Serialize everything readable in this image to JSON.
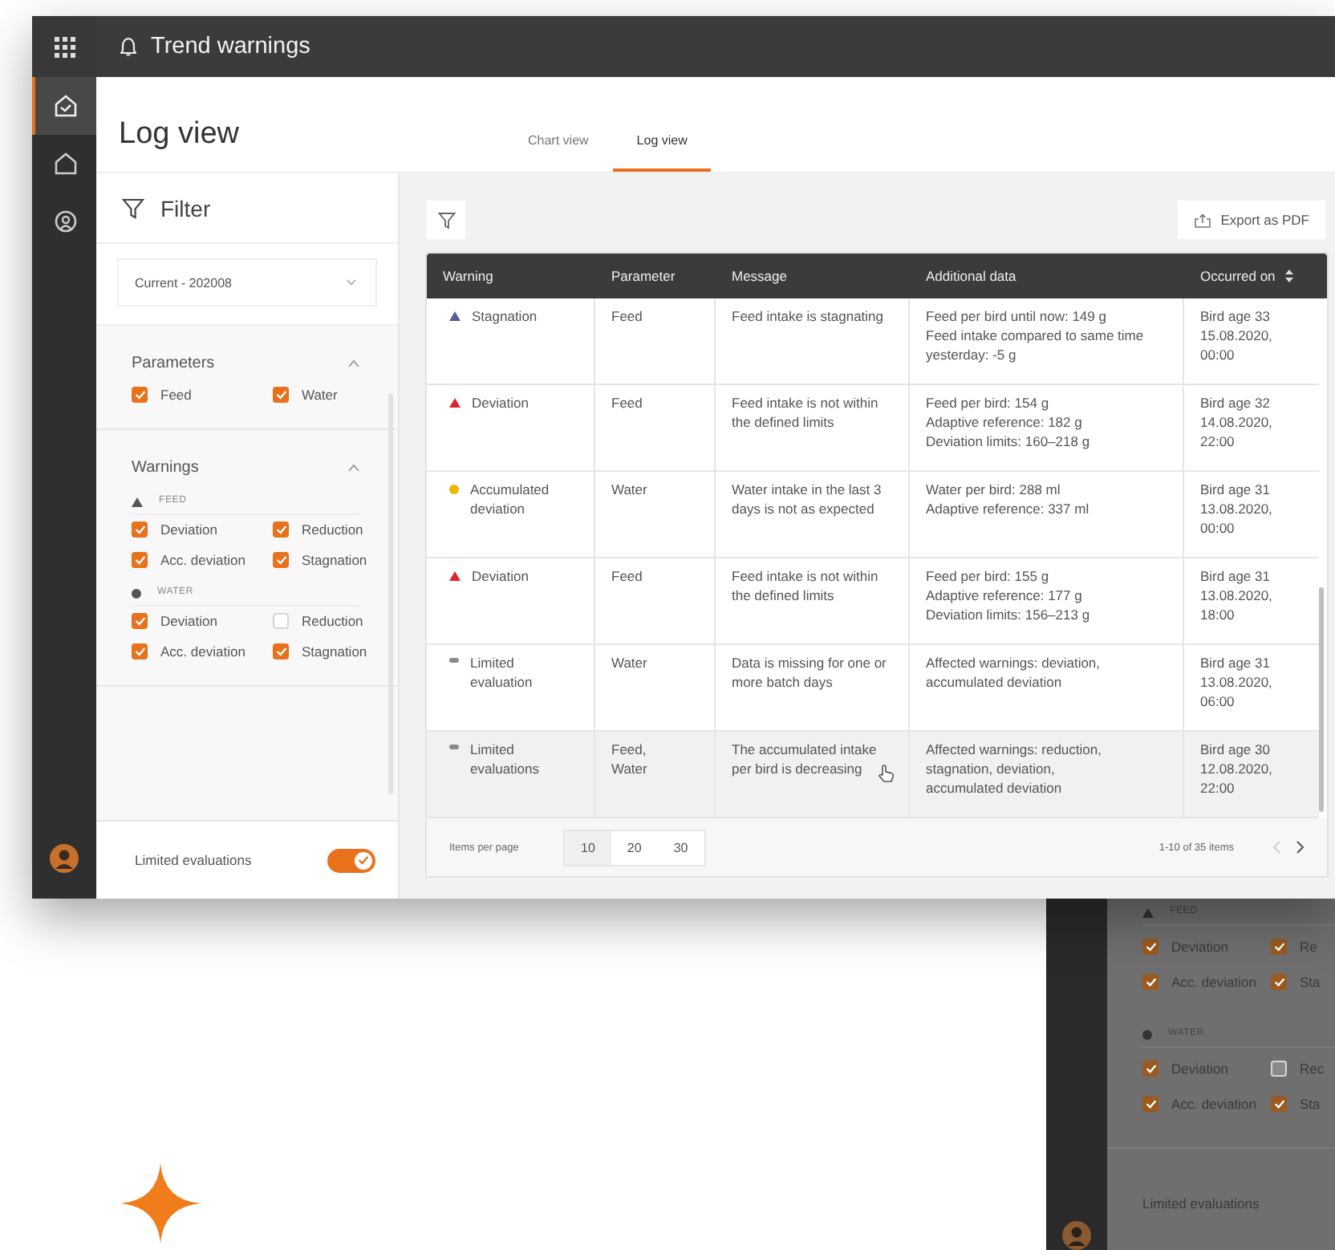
{
  "app_bar": {
    "title": "Trend warnings"
  },
  "rail": {
    "items": [
      {
        "kind": "check-house",
        "selected": true
      },
      {
        "kind": "house",
        "selected": false
      },
      {
        "kind": "person",
        "selected": false
      }
    ]
  },
  "page_title": "Log view",
  "tabs": [
    {
      "label": "Chart view",
      "selected": false
    },
    {
      "label": "Log view",
      "selected": true
    }
  ],
  "filter": {
    "title": "Filter",
    "period": "Current - 202008",
    "sections": [
      {
        "title": "Parameters",
        "expanded": true,
        "groups": [
          {
            "kind": "plain",
            "options": [
              {
                "label": "Feed",
                "checked": true
              },
              {
                "label": "Water",
                "checked": true
              }
            ]
          }
        ]
      },
      {
        "title": "Warnings",
        "expanded": true,
        "groups": [
          {
            "kind": "triangle",
            "name": "FEED",
            "options": [
              {
                "label": "Deviation",
                "checked": true
              },
              {
                "label": "Reduction",
                "checked": true
              },
              {
                "label": "Acc. deviation",
                "checked": true
              },
              {
                "label": "Stagnation",
                "checked": true
              }
            ]
          },
          {
            "kind": "dot",
            "name": "WATER",
            "options": [
              {
                "label": "Deviation",
                "checked": true
              },
              {
                "label": "Reduction",
                "checked": false
              },
              {
                "label": "Acc. deviation",
                "checked": true
              },
              {
                "label": "Stagnation",
                "checked": true
              }
            ]
          }
        ]
      }
    ],
    "limited_evaluations": {
      "label": "Limited evaluations",
      "on": true
    }
  },
  "export_button": {
    "label": "Export as PDF"
  },
  "table": {
    "columns": [
      {
        "label": "Warning",
        "sorted": false
      },
      {
        "label": "Parameter",
        "sorted": false
      },
      {
        "label": "Message",
        "sorted": false
      },
      {
        "label": "Additional data",
        "sorted": false
      },
      {
        "label": "Occurred on",
        "sorted": true
      }
    ],
    "rows": [
      {
        "kind": "triangle",
        "color": "#5a5a9a",
        "warning": "Stagnation",
        "parameter": "Feed",
        "message": "Feed intake is stagnating",
        "additional_data": [
          "Feed per bird until now: 149 g",
          "Feed intake compared to same time yesterday: -5 g"
        ],
        "occurred_on": [
          "Bird age 33",
          "15.08.2020,",
          "00:00"
        ],
        "selected": false
      },
      {
        "kind": "triangle",
        "color": "#e0242a",
        "warning": "Deviation",
        "parameter": "Feed",
        "message": "Feed intake is not within the defined limits",
        "additional_data": [
          "Feed per bird: 154 g",
          "Adaptive reference: 182 g",
          "Deviation limits: 160–218 g"
        ],
        "occurred_on": [
          "Bird age 32",
          "14.08.2020,",
          "22:00"
        ],
        "selected": false
      },
      {
        "kind": "dot",
        "color": "#f0b400",
        "warning": "Accumulated deviation",
        "parameter": "Water",
        "message": "Water intake in the last 3 days is not as expected",
        "additional_data": [
          "Water per bird: 288 ml",
          "Adaptive reference: 337 ml"
        ],
        "occurred_on": [
          "Bird age 31",
          "13.08.2020,",
          "00:00"
        ],
        "selected": false
      },
      {
        "kind": "triangle",
        "color": "#e0242a",
        "warning": "Deviation",
        "parameter": "Feed",
        "message": "Feed intake is not within the defined limits",
        "additional_data": [
          "Feed per bird: 155 g",
          "Adaptive reference: 177 g",
          "Deviation limits: 156–213 g"
        ],
        "occurred_on": [
          "Bird age 31",
          "13.08.2020,",
          "18:00"
        ],
        "selected": false
      },
      {
        "kind": "dash",
        "color": "#8a8a8a",
        "warning": "Limited evaluation",
        "parameter": "Water",
        "message": "Data is missing for one or more batch days",
        "additional_data": [
          "Affected warnings: deviation,",
          "accumulated deviation"
        ],
        "occurred_on": [
          "Bird age 31",
          "13.08.2020,",
          "06:00"
        ],
        "selected": false
      },
      {
        "kind": "dash",
        "color": "#8a8a8a",
        "warning": "Limited evaluations",
        "parameter": "Feed, Water",
        "message": "The accumulated intake per bird is decreasing",
        "additional_data": [
          "Affected warnings: reduction,",
          "stagnation, deviation,",
          "accumulated deviation"
        ],
        "occurred_on": [
          "Bird age 30",
          "12.08.2020,",
          "22:00"
        ],
        "selected": true
      }
    ]
  },
  "pagination": {
    "label": "Items per page",
    "sizes": [
      {
        "label": "10",
        "selected": true
      },
      {
        "label": "20",
        "selected": false
      },
      {
        "label": "30",
        "selected": false
      }
    ],
    "range": "1-10 of 35 items",
    "previous_disabled": true,
    "next_disabled": false
  },
  "background_window": {
    "groups": [
      {
        "kind": "triangle",
        "name": "FEED",
        "options": [
          {
            "label": "Deviation",
            "checked": true
          },
          {
            "label": "Re",
            "checked": true
          },
          {
            "label": "Acc. deviation",
            "checked": true
          },
          {
            "label": "Sta",
            "checked": true
          }
        ]
      },
      {
        "kind": "dot",
        "name": "WATER",
        "options": [
          {
            "label": "Deviation",
            "checked": true
          },
          {
            "label": "Rec",
            "checked": false
          },
          {
            "label": "Acc. deviation",
            "checked": true
          },
          {
            "label": "Sta",
            "checked": true
          }
        ]
      }
    ],
    "limited_evaluations": "Limited evaluations"
  }
}
